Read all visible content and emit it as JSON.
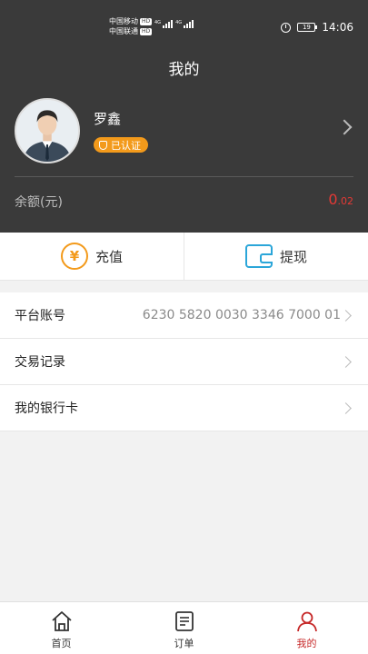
{
  "status_bar": {
    "carrier_1": "中国移动",
    "carrier_2": "中国联通",
    "hd_badge": "HD",
    "network_1": "4G",
    "network_2": "4G",
    "battery": "19",
    "time": "14:06"
  },
  "header": {
    "title": "我的"
  },
  "profile": {
    "name": "罗鑫",
    "verified_label": "已认证"
  },
  "balance": {
    "label": "余额(元)",
    "value_int": "0",
    "value_decimal": ".02"
  },
  "actions": {
    "recharge_label": "充值",
    "withdraw_label": "提现"
  },
  "menu": {
    "items": [
      {
        "label": "平台账号",
        "value": "6230 5820 0030 3346 7000 01"
      },
      {
        "label": "交易记录",
        "value": ""
      },
      {
        "label": "我的银行卡",
        "value": ""
      }
    ]
  },
  "tabbar": {
    "items": [
      {
        "label": "首页",
        "icon": "home-icon"
      },
      {
        "label": "订单",
        "icon": "order-icon"
      },
      {
        "label": "我的",
        "icon": "user-icon"
      }
    ],
    "active_color": "#c62828"
  },
  "colors": {
    "header_bg": "#3a3a3a",
    "accent_orange": "#f39a1b",
    "accent_blue": "#2ba6d9",
    "balance_red": "#e53935"
  }
}
